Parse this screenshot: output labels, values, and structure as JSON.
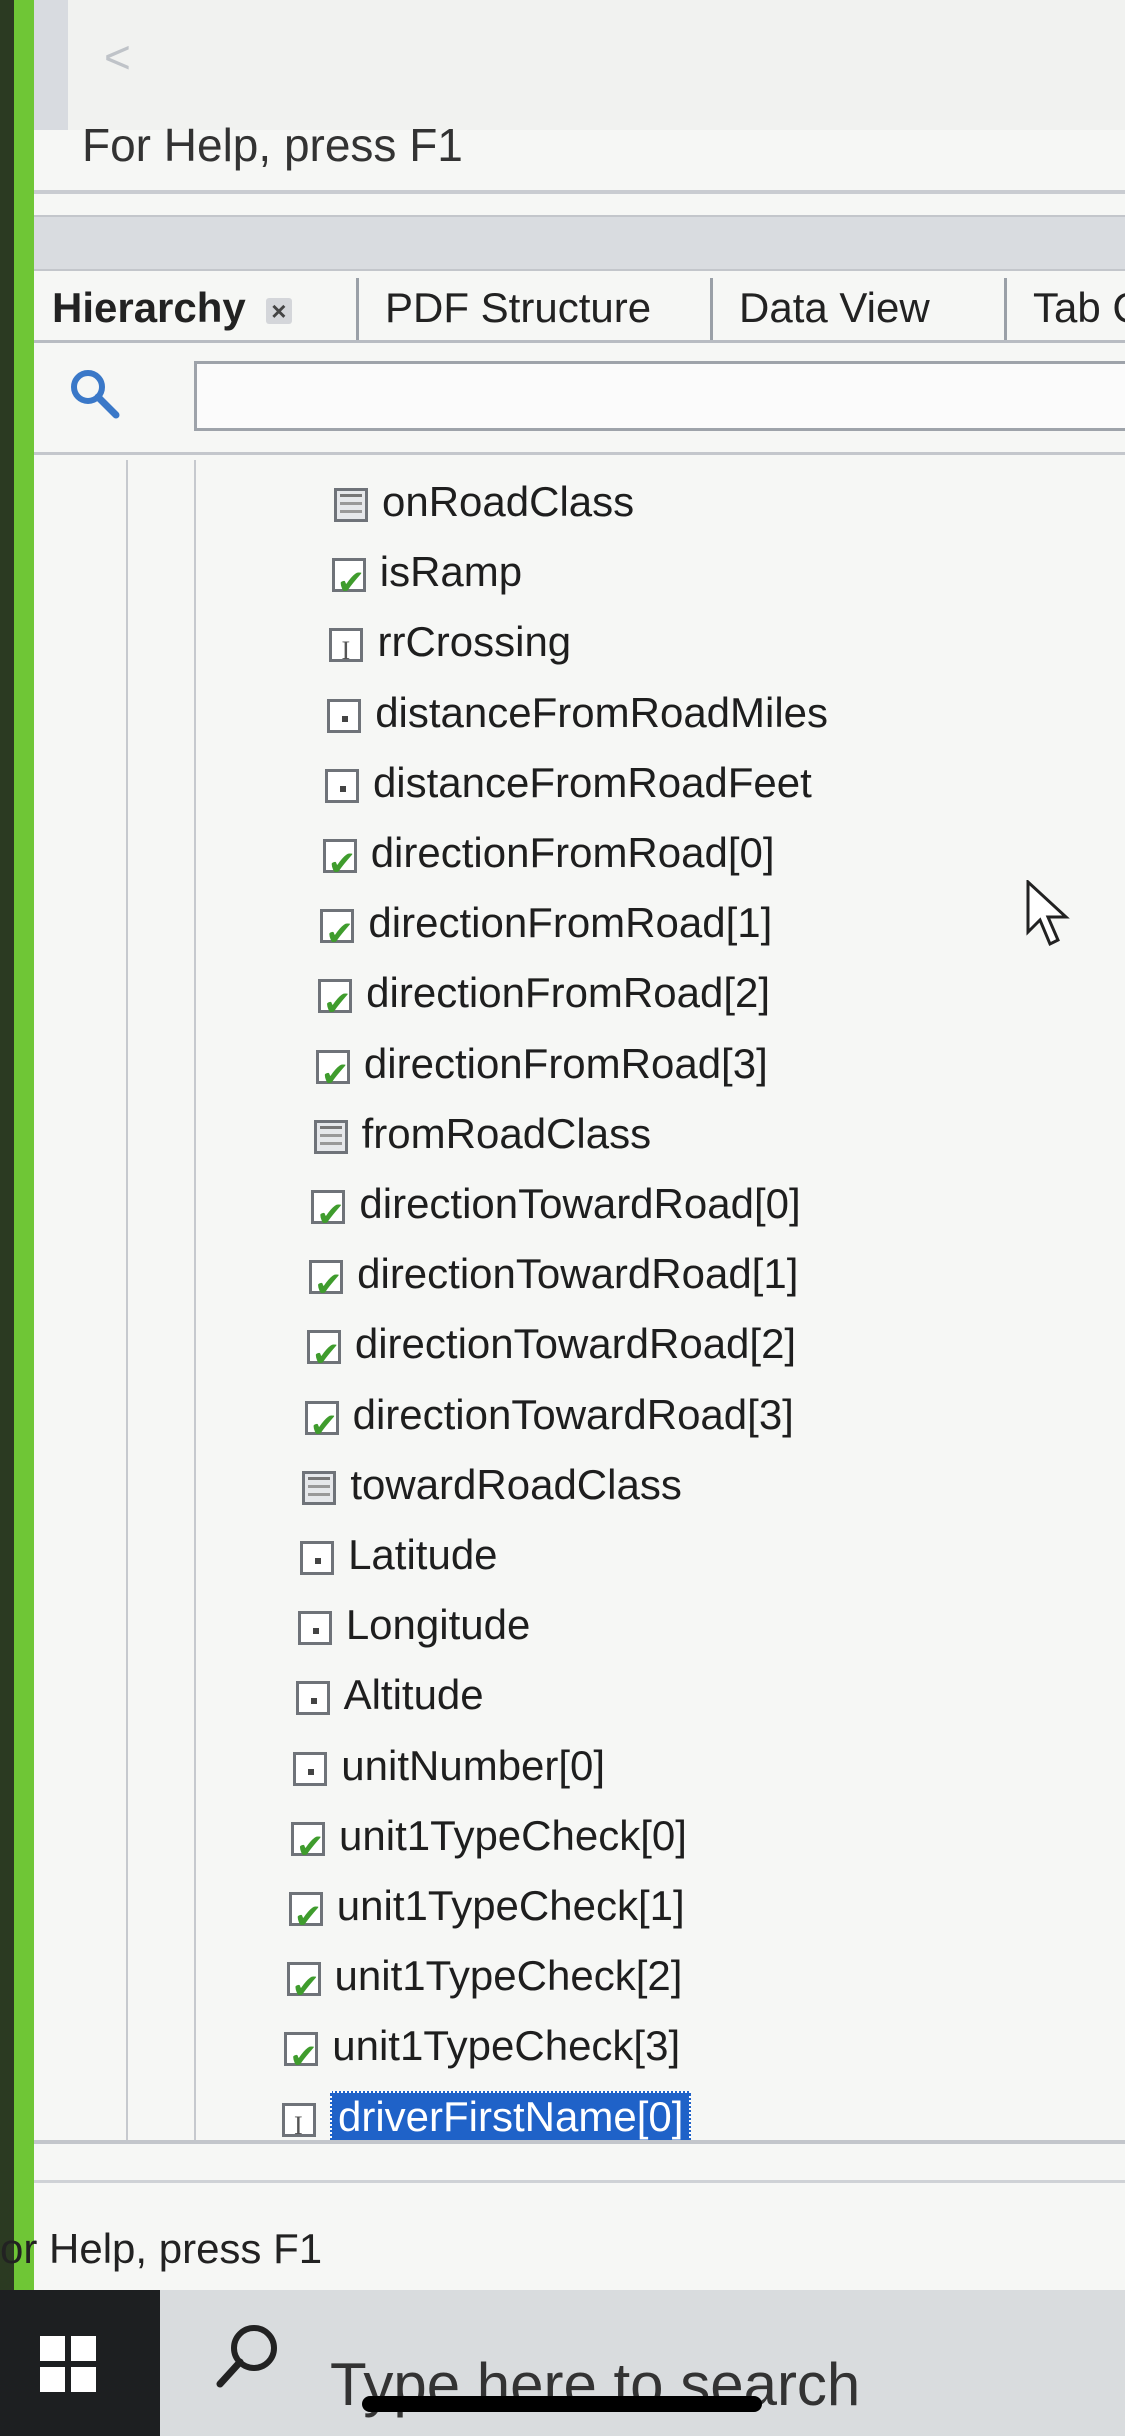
{
  "window": {
    "back_glyph": "<",
    "status_text_top": "For Help, press F1",
    "status_text_bottom": "or Help, press F1"
  },
  "tabs": [
    {
      "label": "Hierarchy",
      "active": true,
      "close_glyph": "×"
    },
    {
      "label": "PDF Structure",
      "active": false
    },
    {
      "label": "Data View",
      "active": false
    },
    {
      "label": "Tab C",
      "active": false
    }
  ],
  "search": {
    "placeholder": "",
    "value": ""
  },
  "tree": {
    "items": [
      {
        "label": "onRoadClass",
        "icon": "combo-box-icon"
      },
      {
        "label": "isRamp",
        "icon": "checkbox-icon"
      },
      {
        "label": "rrCrossing",
        "icon": "text-field-icon"
      },
      {
        "label": "distanceFromRoadMiles",
        "icon": "numeric-field-icon"
      },
      {
        "label": "distanceFromRoadFeet",
        "icon": "numeric-field-icon"
      },
      {
        "label": "directionFromRoad[0]",
        "icon": "checkbox-icon"
      },
      {
        "label": "directionFromRoad[1]",
        "icon": "checkbox-icon"
      },
      {
        "label": "directionFromRoad[2]",
        "icon": "checkbox-icon"
      },
      {
        "label": "directionFromRoad[3]",
        "icon": "checkbox-icon"
      },
      {
        "label": "fromRoadClass",
        "icon": "combo-box-icon"
      },
      {
        "label": "directionTowardRoad[0]",
        "icon": "checkbox-icon"
      },
      {
        "label": "directionTowardRoad[1]",
        "icon": "checkbox-icon"
      },
      {
        "label": "directionTowardRoad[2]",
        "icon": "checkbox-icon"
      },
      {
        "label": "directionTowardRoad[3]",
        "icon": "checkbox-icon"
      },
      {
        "label": "towardRoadClass",
        "icon": "combo-box-icon"
      },
      {
        "label": "Latitude",
        "icon": "numeric-field-icon"
      },
      {
        "label": "Longitude",
        "icon": "numeric-field-icon"
      },
      {
        "label": "Altitude",
        "icon": "numeric-field-icon"
      },
      {
        "label": "unitNumber[0]",
        "icon": "numeric-field-icon"
      },
      {
        "label": "unit1TypeCheck[0]",
        "icon": "checkbox-icon"
      },
      {
        "label": "unit1TypeCheck[1]",
        "icon": "checkbox-icon"
      },
      {
        "label": "unit1TypeCheck[2]",
        "icon": "checkbox-icon"
      },
      {
        "label": "unit1TypeCheck[3]",
        "icon": "checkbox-icon"
      },
      {
        "label": "driverFirstName[0]",
        "icon": "text-field-icon",
        "selected": true
      }
    ]
  },
  "taskbar": {
    "search_text": "Type here to search"
  },
  "colors": {
    "selection": "#1f62c8",
    "check": "#3f9c2d",
    "accent_edge": "#6fc636"
  }
}
